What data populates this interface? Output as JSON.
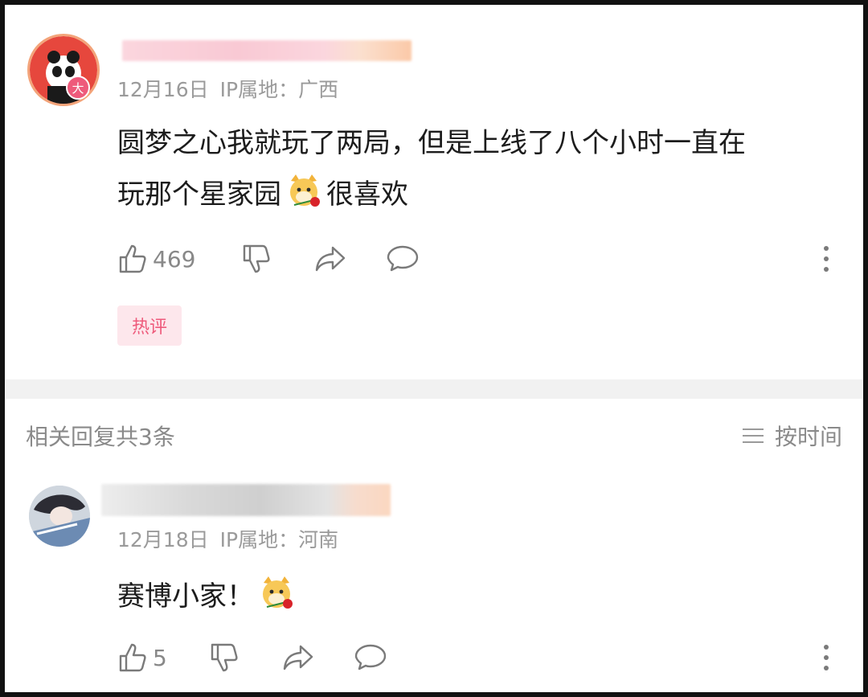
{
  "comment": {
    "date": "12月16日",
    "ip_label": "IP属地：广西",
    "text_line1": "圆梦之心我就玩了两局，但是上线了八个小时一直在",
    "text_line2_before": "玩那个星家园",
    "text_line2_after": "很喜欢",
    "like_count": "469",
    "hot_tag": "热评",
    "avatar_badge": "大",
    "emoji": "dog-with-rose-emoji"
  },
  "replies_header": {
    "title": "相关回复共3条",
    "sort_label": "按时间"
  },
  "reply": {
    "date": "12月18日",
    "ip_label": "IP属地：河南",
    "text": "赛博小家！",
    "like_count": "5",
    "emoji": "dog-with-rose-emoji"
  },
  "colors": {
    "hot_tag_bg": "#fde7ec",
    "hot_tag_text": "#ee5a7b",
    "meta_text": "#9a9a9a",
    "divider": "#f1f1f1"
  }
}
